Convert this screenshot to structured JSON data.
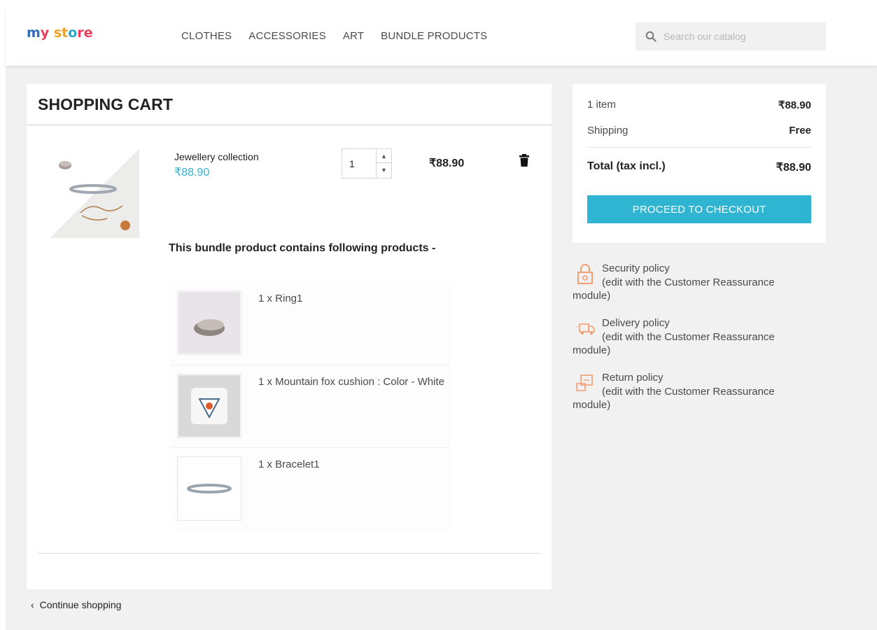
{
  "header": {
    "logo": {
      "part1": "m",
      "part2": "y",
      "part3": " st",
      "part4": "o",
      "part5": "re"
    },
    "nav": [
      "CLOTHES",
      "ACCESSORIES",
      "ART",
      "BUNDLE PRODUCTS"
    ],
    "search_placeholder": "Search our catalog"
  },
  "cart": {
    "title": "SHOPPING CART",
    "product": {
      "name": "Jewellery collection",
      "price": "₹88.90",
      "quantity": "1",
      "line_total": "₹88.90"
    },
    "bundle_heading": "This bundle product contains following products -",
    "bundle_items": [
      {
        "label": "1 x Ring1"
      },
      {
        "label": "1 x Mountain fox cushion : Color - White"
      },
      {
        "label": "1 x Bracelet1"
      }
    ],
    "continue_label": "Continue shopping"
  },
  "summary": {
    "items_label": "1 item",
    "items_value": "₹88.90",
    "shipping_label": "Shipping",
    "shipping_value": "Free",
    "total_label": "Total (tax incl.)",
    "total_value": "₹88.90",
    "checkout_label": "PROCEED TO CHECKOUT"
  },
  "reassurance": [
    {
      "title": "Security policy",
      "desc": "(edit with the Customer Reassurance module)",
      "icon": "lock-icon"
    },
    {
      "title": "Delivery policy",
      "desc": "(edit with the Customer Reassurance module)",
      "icon": "truck-icon"
    },
    {
      "title": "Return policy",
      "desc": "(edit with the Customer Reassurance module)",
      "icon": "return-box-icon"
    }
  ],
  "colors": {
    "accent": "#2fb5d2",
    "icon_orange": "#f39d72"
  }
}
